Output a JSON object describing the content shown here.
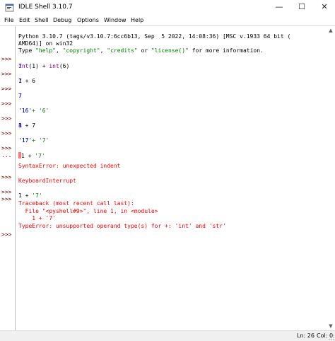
{
  "window": {
    "title": "IDLE Shell 3.10.7",
    "minimize_glyph": "—",
    "maximize_glyph": "☐",
    "close_glyph": "✕"
  },
  "menu": [
    "File",
    "Edit",
    "Shell",
    "Debug",
    "Options",
    "Window",
    "Help"
  ],
  "banner": {
    "line1": "Python 3.10.7 (tags/v3.10.7:6cc6b13, Sep  5 2022, 14:08:36) [MSC v.1933 64 bit (",
    "line2": "AMD64)] on win32",
    "line3_pre": "Type ",
    "line3_s1": "\"help\"",
    "line3_c1": ", ",
    "line3_s2": "\"copyright\"",
    "line3_c2": ", ",
    "line3_s3": "\"credits\"",
    "line3_or": " or ",
    "line3_s4": "\"license()\"",
    "line3_post": " for more information."
  },
  "prompt": ">>>",
  "continuation": "...",
  "session": {
    "l1_a": "int",
    "l1_b": "(1) + ",
    "l1_c": "int",
    "l1_d": "(6)",
    "o1": "7",
    "l2": "1 + 6",
    "o2": "7",
    "l3": "7",
    "o3": "7",
    "l4": "'1' + '6'",
    "o4": "'16'",
    "l5": "1 + 7",
    "o5": "8",
    "l6": "'1' + '7'",
    "o6": "'17'",
    "l7_a": "1 + ",
    "l7_b": "'7'",
    "e1": "SyntaxError: unexpected indent",
    "e2": "KeyboardInterrupt",
    "l8_a": "1 + ",
    "l8_b": "'7'",
    "tb1": "Traceback (most recent call last):",
    "tb2": "  File \"<pyshell#9>\", line 1, in <module>",
    "tb3": "    1 + '7'",
    "tb4": "TypeError: unsupported operand type(s) for +: 'int' and 'str'"
  },
  "status": {
    "ln": "Ln: 26",
    "col": "Col: 0"
  },
  "colors": {
    "prompt": "#7f0000",
    "output": "#0000ff",
    "string": "#008000",
    "builtin": "#900090",
    "error": "#ff0000"
  }
}
